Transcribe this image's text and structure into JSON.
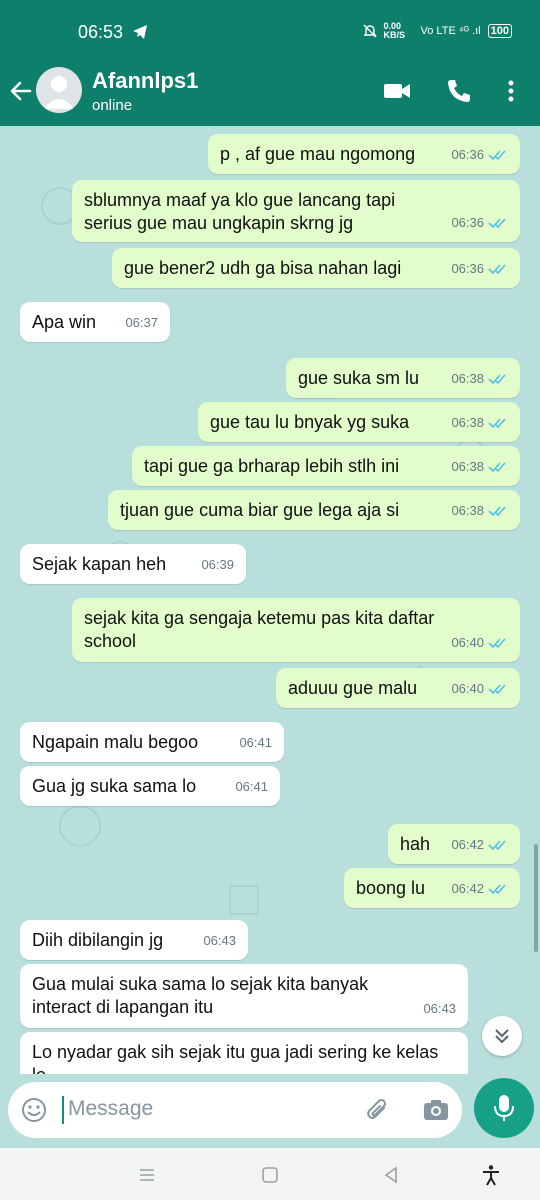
{
  "status_bar": {
    "time": "06:53",
    "net_speed": "0.00 KB/S",
    "signal": "Vo LTE ⁴ᴳ .ıl",
    "battery": "100",
    "icons": [
      "telegram-icon",
      "mute-icon",
      "signal-icon",
      "battery-icon"
    ]
  },
  "header": {
    "contact_name": "Afannlps1",
    "status": "online",
    "icons": [
      "back-arrow-icon",
      "video-call-icon",
      "voice-call-icon",
      "more-vert-icon"
    ]
  },
  "messages": [
    {
      "dir": "out",
      "text": "p , af gue mau ngomong",
      "time": "06:36"
    },
    {
      "dir": "out",
      "text": "sblumnya maaf ya klo gue lancang tapi serius gue mau ungkapin skrng jg",
      "time": "06:36"
    },
    {
      "dir": "out",
      "text": "gue bener2 udh ga bisa nahan lagi",
      "time": "06:36"
    },
    {
      "dir": "in",
      "text": "Apa win",
      "time": "06:37"
    },
    {
      "dir": "out",
      "text": "gue suka sm lu",
      "time": "06:38"
    },
    {
      "dir": "out",
      "text": "gue tau lu bnyak yg suka",
      "time": "06:38"
    },
    {
      "dir": "out",
      "text": "tapi gue ga brharap lebih stlh ini",
      "time": "06:38"
    },
    {
      "dir": "out",
      "text": "tjuan gue cuma biar gue lega aja si",
      "time": "06:38"
    },
    {
      "dir": "in",
      "text": "Sejak kapan heh",
      "time": "06:39"
    },
    {
      "dir": "out",
      "text": "sejak kita ga sengaja ketemu pas kita daftar school",
      "time": "06:40"
    },
    {
      "dir": "out",
      "text": "aduuu gue malu",
      "time": "06:40"
    },
    {
      "dir": "in",
      "text": "Ngapain malu begoo",
      "time": "06:41"
    },
    {
      "dir": "in",
      "text": "Gua jg suka sama lo",
      "time": "06:41"
    },
    {
      "dir": "out",
      "text": "hah",
      "time": "06:42"
    },
    {
      "dir": "out",
      "text": "boong lu",
      "time": "06:42"
    },
    {
      "dir": "in",
      "text": "Diih dibilangin jg",
      "time": "06:43"
    },
    {
      "dir": "in",
      "text": "Gua mulai suka sama lo sejak kita banyak interact di lapangan itu",
      "time": "06:43"
    },
    {
      "dir": "in",
      "text": "Lo nyadar gak sih sejak itu gua jadi sering ke kelas lo",
      "time": ""
    }
  ],
  "composer": {
    "placeholder": "Message",
    "icons": [
      "emoji-icon",
      "attach-icon",
      "camera-icon",
      "mic-icon"
    ]
  },
  "nav_bar": {
    "icons": [
      "menu-icon",
      "home-icon",
      "back-icon",
      "accessibility-icon"
    ]
  },
  "colors": {
    "header": "#0e7f6b",
    "chat_bg": "#b9dfdd",
    "outgoing": "#e2fdcb",
    "incoming": "#ffffff",
    "ticks": "#53bdeb",
    "mic": "#16a085"
  }
}
